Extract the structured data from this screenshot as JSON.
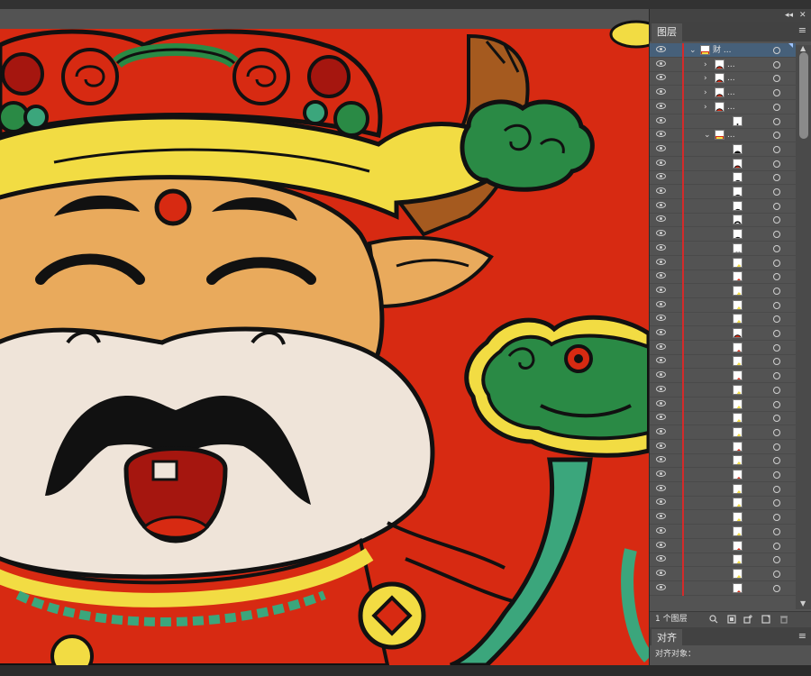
{
  "colors": {
    "artboard_red": "#d72a12",
    "skin": "#e9aa5c",
    "muzzle": "#efe4d9",
    "gold": "#f2dc43",
    "green": "#2a8a45",
    "teal": "#3ba67c",
    "dark_red": "#a5160f",
    "outline": "#111111",
    "horn": "#a55a1f",
    "layer_color_bar": "#d42a2a",
    "selection": "#46607a"
  },
  "layers_panel": {
    "tab_label": "图层",
    "menu_icon": "hamburger-menu-icon",
    "top_layer_name": "财 ...",
    "sublayer_name": "...",
    "layer_count_label": "1 个图层"
  },
  "align_panel": {
    "tab_label": "对齐",
    "align_to_label": "对齐对象："
  },
  "dock": {
    "collapse_icon": "double-chevron-icon",
    "close_icon": "close-icon"
  },
  "layer_rows": [
    {
      "kind": "layer",
      "name": "财 ...",
      "thumb": "artwork",
      "expanded": true,
      "selected": true
    },
    {
      "kind": "group",
      "name": "...",
      "thumb": "red-circle"
    },
    {
      "kind": "group",
      "name": "...",
      "thumb": "red-circle"
    },
    {
      "kind": "group",
      "name": "...",
      "thumb": "red-circle"
    },
    {
      "kind": "group",
      "name": "...",
      "thumb": "red-circle"
    },
    {
      "kind": "item",
      "thumb": "dots"
    },
    {
      "kind": "group",
      "name": "...",
      "thumb": "artwork",
      "expanded": true
    },
    {
      "kind": "item",
      "thumb": "black-dot"
    },
    {
      "kind": "item",
      "thumb": "red-ring"
    },
    {
      "kind": "item",
      "thumb": "black-arc"
    },
    {
      "kind": "item",
      "thumb": "black-arc"
    },
    {
      "kind": "item",
      "thumb": "black-arc"
    },
    {
      "kind": "item",
      "thumb": "black-ring"
    },
    {
      "kind": "item",
      "thumb": "black-arc"
    },
    {
      "kind": "item",
      "thumb": "green-cloud"
    },
    {
      "kind": "item",
      "thumb": "gold-stroke"
    },
    {
      "kind": "item",
      "thumb": "red-stroke"
    },
    {
      "kind": "item",
      "thumb": "gold-stroke"
    },
    {
      "kind": "item",
      "thumb": "gold-stroke"
    },
    {
      "kind": "item",
      "thumb": "gold-stroke"
    },
    {
      "kind": "item",
      "thumb": "red-circle"
    },
    {
      "kind": "item",
      "thumb": "red-stroke"
    },
    {
      "kind": "item",
      "thumb": "gold-stroke"
    },
    {
      "kind": "item",
      "thumb": "red-stroke"
    },
    {
      "kind": "item",
      "thumb": "gold-stroke"
    },
    {
      "kind": "item",
      "thumb": "gold-stroke"
    },
    {
      "kind": "item",
      "thumb": "gold-stroke"
    },
    {
      "kind": "item",
      "thumb": "gold-stroke"
    },
    {
      "kind": "item",
      "thumb": "red-stroke"
    },
    {
      "kind": "item",
      "thumb": "gold-stroke"
    },
    {
      "kind": "item",
      "thumb": "red-stroke"
    },
    {
      "kind": "item",
      "thumb": "gold-stroke"
    },
    {
      "kind": "item",
      "thumb": "gold-stroke"
    },
    {
      "kind": "item",
      "thumb": "gold-stroke"
    },
    {
      "kind": "item",
      "thumb": "gold-stroke"
    },
    {
      "kind": "item",
      "thumb": "red-stroke"
    },
    {
      "kind": "item",
      "thumb": "gold-stroke"
    },
    {
      "kind": "item",
      "thumb": "gold-stroke"
    },
    {
      "kind": "item",
      "thumb": "red-stroke"
    }
  ]
}
